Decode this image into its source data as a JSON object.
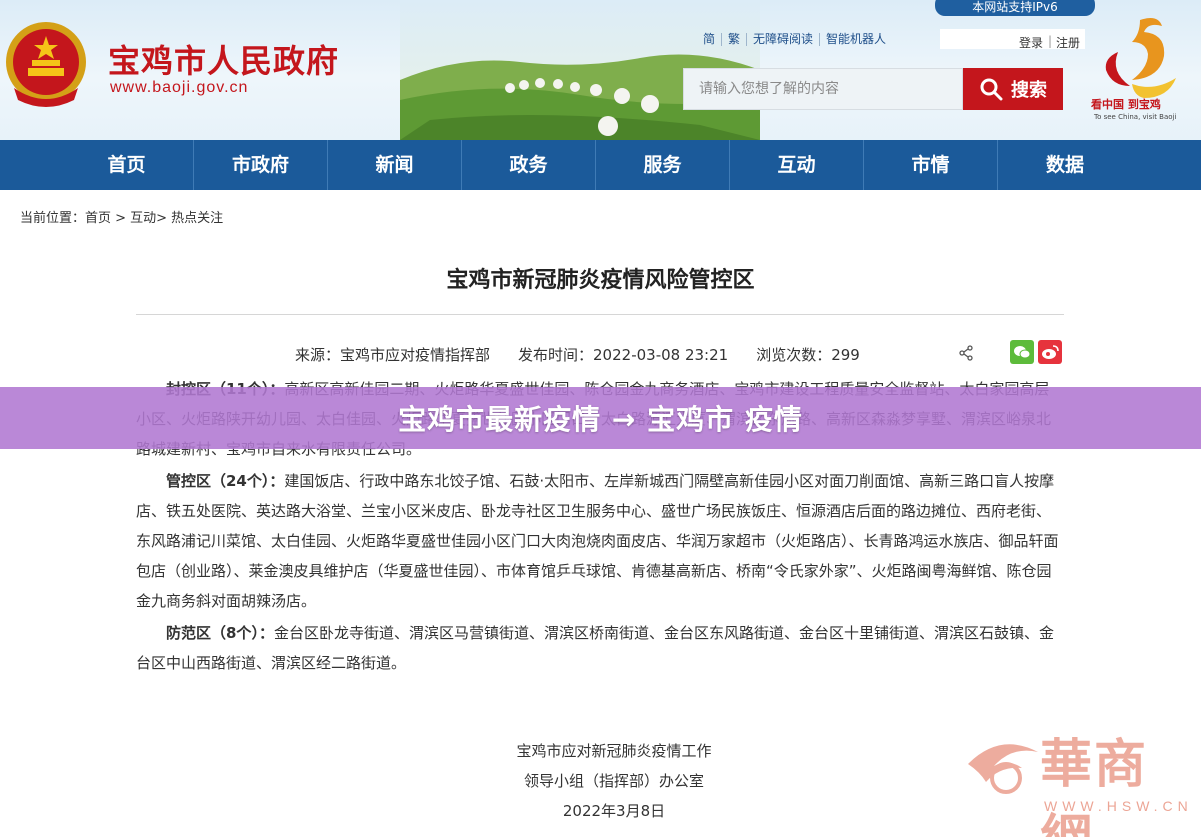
{
  "header": {
    "site_title": "宝鸡市人民政府",
    "site_url": "www.baoji.gov.cn",
    "ipv6_badge": "本网站支持IPv6",
    "top_links": [
      "简",
      "繁",
      "无障碍阅读",
      "智能机器人"
    ],
    "login": "登录",
    "separator": "|",
    "register": "注册",
    "search_placeholder": "请输入您想了解的内容",
    "search_button": "搜索",
    "right_logo_text": "看中国 到宝鸡",
    "right_logo_sub": "To see China, visit Baoji"
  },
  "nav": {
    "items": [
      "首页",
      "市政府",
      "新闻",
      "政务",
      "服务",
      "互动",
      "市情",
      "数据"
    ]
  },
  "breadcrumb": "当前位置：首页 > 互动> 热点关注",
  "article": {
    "title": "宝鸡市新冠肺炎疫情风险管控区",
    "source": "来源：宝鸡市应对疫情指挥部",
    "published": "发布时间：2022-03-08 23:21",
    "views": "浏览次数：299",
    "paragraphs": [
      {
        "key": "封控区（11个）：",
        "text": "高新区高新佳园二期、火炬路华夏盛世佳园、陈仓园金九商务酒店、宝鸡市建设工程质量安全监督站、太白家园高层小区、火炬路陕开幼儿园、太白佳园、火炬路华夏盛世佳园小区门口、太白路源汇大厦、渭滨区东风路、高新区森淼梦享墅、渭滨区峪泉北路城建新村、宝鸡市自来水有限责任公司。"
      },
      {
        "key": "管控区（24个）：",
        "text": "建国饭店、行政中路东北饺子馆、石鼓·太阳市、左岸新城西门隔壁高新佳园小区对面刀削面馆、高新三路口盲人按摩店、铁五处医院、英达路大浴堂、兰宝小区米皮店、卧龙寺社区卫生服务中心、盛世广场民族饭庄、恒源酒店后面的路边摊位、西府老街、东风路浦记川菜馆、太白佳园、火炬路华夏盛世佳园小区门口大肉泡烧肉面皮店、华润万家超市（火炬路店）、长青路鸿运水族店、御品轩面包店（创业路）、莱金澳皮具维护店（华夏盛世佳园）、市体育馆乒乓球馆、肯德基高新店、桥南“令氏家外家”、火炬路闽粤海鲜馆、陈仓园金九商务斜对面胡辣汤店。"
      },
      {
        "key": "防范区（8个）：",
        "text": "金台区卧龙寺街道、渭滨区马营镇街道、渭滨区桥南街道、金台区东风路街道、金台区十里铺街道、渭滨区石鼓镇、金台区中山西路街道、渭滨区经二路街道。"
      }
    ],
    "signature": [
      "宝鸡市应对新冠肺炎疫情工作",
      "领导小组（指挥部）办公室",
      "2022年3月8日"
    ]
  },
  "overlay_banner": "宝鸡市最新疫情 → 宝鸡市 疫情",
  "watermark": {
    "cn": "華商網",
    "en": "WWW.HSW.CN"
  },
  "colors": {
    "brand_red": "#c4161c",
    "nav_blue": "#1b5a9a",
    "overlay_purple": "#b078d2"
  }
}
